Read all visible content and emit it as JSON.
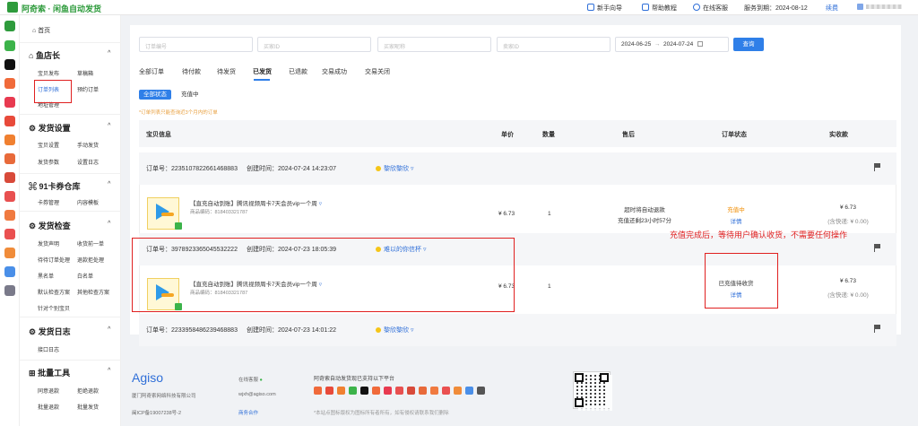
{
  "brand": {
    "title": "阿奇索 · 闲鱼自动发货"
  },
  "topnav": {
    "guide": "新手向导",
    "tutorial": "帮助教程",
    "support": "在线客服",
    "expiry": "服务到期：2024-08-12",
    "renew": "续费"
  },
  "rail": [
    "闲鱼",
    "天猫",
    "1688",
    "拼多多",
    "店铺",
    "发货",
    "京东",
    "有赞",
    "小红书",
    "88",
    "工具"
  ],
  "sidebar": {
    "home": "首页",
    "s1": {
      "title": "鱼店长",
      "items": [
        "宝贝发布",
        "草稿箱",
        "订单列表",
        "预约订单",
        "地址管理"
      ]
    },
    "s2": {
      "title": "发货设置",
      "items": [
        "宝贝设置",
        "手动发货",
        "发货参数",
        "设置日志"
      ]
    },
    "s3": {
      "title": "91卡券仓库",
      "items": [
        "卡券管理",
        "内容模板"
      ]
    },
    "s4": {
      "title": "发货检查",
      "items": [
        "发货声明",
        "收货前一单",
        "待待订单处理",
        "退款拒处理",
        "黑名单",
        "白名单",
        "默认检查方案",
        "其他检查方案",
        "针对个别宝贝"
      ]
    },
    "s5": {
      "title": "发货日志",
      "items": [
        "接口日志"
      ]
    },
    "s6": {
      "title": "批量工具",
      "items": [
        "同意退款",
        "拒绝退款",
        "批量退款",
        "批量发货"
      ]
    }
  },
  "filters": {
    "order_no": "订单编号",
    "buyer_id": "买家ID",
    "buyer_nick": "买家昵称",
    "seller_id": "卖家ID",
    "date_from": "2024-06-25",
    "date_sep": "→",
    "date_to": "2024-07-24",
    "query": "查询"
  },
  "tabs": [
    "全部订单",
    "待付款",
    "待发货",
    "已发货",
    "已退款",
    "交易成功",
    "交易关闭"
  ],
  "segments": {
    "all": "全部状态",
    "charging": "充值中"
  },
  "notice": "*订单列表只能查询近3个月内的订单",
  "columns": {
    "info": "宝贝信息",
    "price": "单价",
    "qty": "数量",
    "after": "售后",
    "status": "订单状态",
    "paid": "实收款"
  },
  "orders": [
    {
      "order_no": "订单号：2235107822661468883",
      "created": "创建时间：2024-07-24 14:23:07",
      "wangwang": "黎欣黎欣",
      "title": "【直充自动到账】腾讯视频周卡7天会员vip一个周",
      "code": "商品编码：818403321787",
      "price": "¥ 6.73",
      "qty": "1",
      "after1": "超时将自动退款",
      "after2": "充值还剩23小时57分",
      "status": "充值中",
      "detail": "详情",
      "paid": "¥ 6.73",
      "shipping": "(含快递: ¥ 0.00)"
    },
    {
      "order_no": "订单号：3978923365045532222",
      "created": "创建时间：2024-07-23 18:05:39",
      "wangwang": "难以的你信杯",
      "title": "【直充自动到账】腾讯视频周卡7天会员vip一个周",
      "code": "商品编码：818403321787",
      "price": "¥ 6.73",
      "qty": "1",
      "status": "已充值待收货",
      "detail": "详情",
      "paid": "¥ 6.73",
      "shipping": "(含快递: ¥ 0.00)"
    },
    {
      "order_no": "订单号：2233958486239468883",
      "created": "创建时间：2024-07-23 14:01:22",
      "wangwang": "黎欣黎欣"
    }
  ],
  "annotation": "充值完成后，等待用户确认收货，不需要任何操作",
  "footer": {
    "agiso": "Agiso",
    "company": "厦门阿奇索网络科技有限公司",
    "icp": "闽ICP备19007238号-2",
    "support": "在线客服",
    "email": "wjxh@agiso.com",
    "biz": "商务合作",
    "platforms": "阿奇索自动发货现已支持以下平台",
    "disclaimer": "*本站点图标版权为图标所有者所有，如有侵权请联系我们删除"
  },
  "colors": {
    "accent": "#2f7fe8",
    "brand": "#2e9b3c",
    "annotation": "#e02020",
    "status": "#f08c00"
  }
}
